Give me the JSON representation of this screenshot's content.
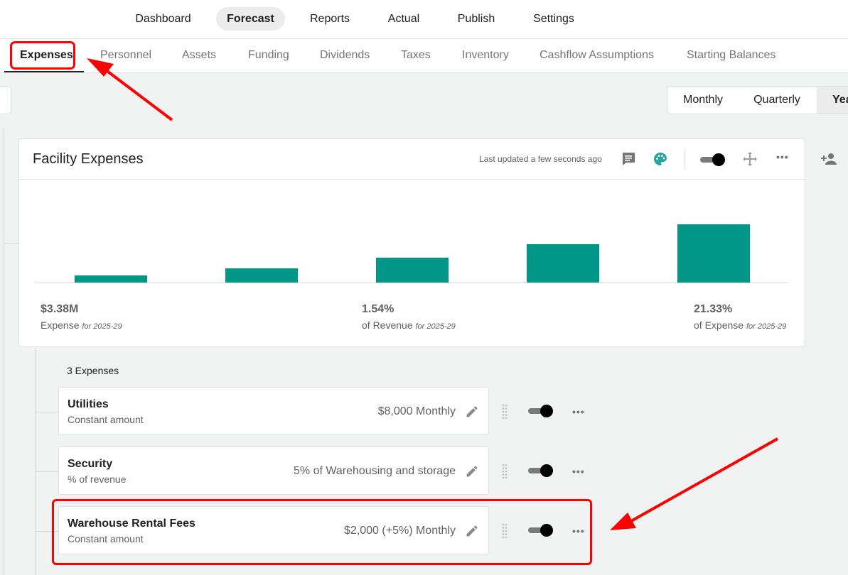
{
  "topnav": {
    "tabs": [
      {
        "label": "Dashboard"
      },
      {
        "label": "Forecast",
        "active": true
      },
      {
        "label": "Reports"
      },
      {
        "label": "Actual"
      },
      {
        "label": "Publish"
      },
      {
        "label": "Settings"
      }
    ]
  },
  "subnav": {
    "tabs": [
      {
        "label": "Expenses",
        "active": true
      },
      {
        "label": "Personnel"
      },
      {
        "label": "Assets"
      },
      {
        "label": "Funding"
      },
      {
        "label": "Dividends"
      },
      {
        "label": "Taxes"
      },
      {
        "label": "Inventory"
      },
      {
        "label": "Cashflow Assumptions"
      },
      {
        "label": "Starting Balances"
      }
    ]
  },
  "period": {
    "options": [
      "Monthly",
      "Quarterly",
      "Yea"
    ],
    "selected": "Yea"
  },
  "card": {
    "title": "Facility Expenses",
    "last_updated": "Last updated a few seconds ago",
    "icons": [
      "comment-icon",
      "palette-icon",
      "toggle",
      "move-icon",
      "more-icon"
    ],
    "accent_color": "#009688",
    "chart_data": {
      "type": "bar",
      "bar_relative_heights": [
        0.12,
        0.24,
        0.43,
        0.66,
        1.0
      ]
    },
    "kpis": [
      {
        "value": "$3.38M",
        "label": "Expense",
        "period": "for 2025-29"
      },
      {
        "value": "1.54%",
        "label": "of Revenue",
        "period": "for 2025-29"
      },
      {
        "value": "21.33%",
        "label": "of Expense",
        "period": "for 2025-29"
      }
    ]
  },
  "expenses": {
    "count_label": "3 Expenses",
    "items": [
      {
        "name": "Utilities",
        "type": "Constant amount",
        "amount": "$8,000 Monthly",
        "enabled": true
      },
      {
        "name": "Security",
        "type": "% of revenue",
        "amount": "5% of Warehousing and storage",
        "enabled": true
      },
      {
        "name": "Warehouse Rental Fees",
        "type": "Constant amount",
        "amount": "$2,000 (+5%) Monthly",
        "enabled": true
      }
    ]
  },
  "annotation_color": "#ff0000"
}
